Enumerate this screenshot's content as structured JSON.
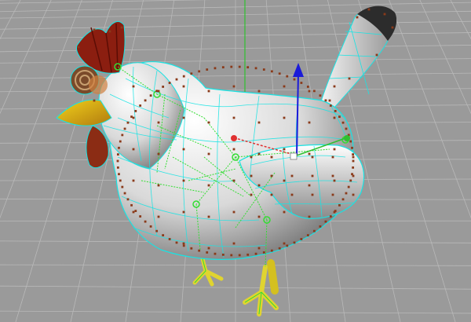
{
  "viewport": {
    "kind": "3d-perspective-viewport",
    "background_color": "#9a9a9a",
    "grid_color": "#b9b9b9",
    "wire_color": "#19e3e3",
    "skeleton_color": "#33dd33",
    "vertex_color": "#8a3a1a"
  },
  "model": {
    "name": "chicken",
    "components": [
      "body",
      "head",
      "comb",
      "wattle",
      "beak",
      "eye",
      "tail",
      "wing",
      "legs"
    ]
  },
  "manipulator": {
    "axes": [
      {
        "name": "x-axis",
        "color": "#e03030"
      },
      {
        "name": "y-axis",
        "color": "#1b1bd8"
      },
      {
        "name": "z-axis",
        "color": "#30c030"
      }
    ]
  }
}
